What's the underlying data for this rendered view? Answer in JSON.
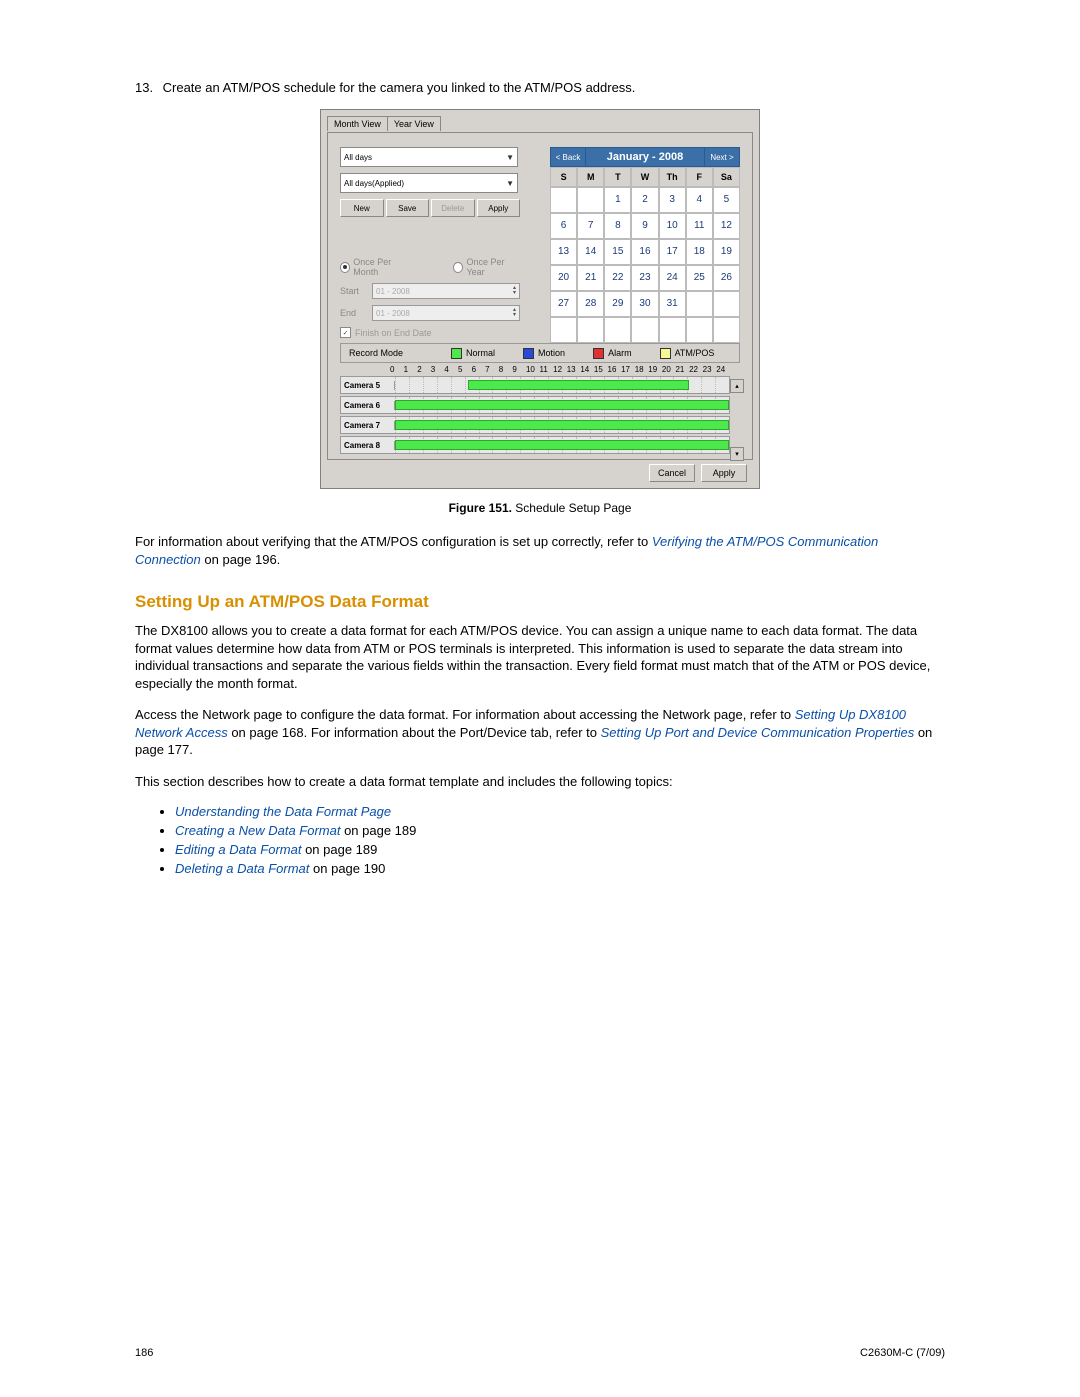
{
  "step": {
    "number": "13.",
    "text": "Create an ATM/POS schedule for the camera you linked to the ATM/POS address."
  },
  "screenshot": {
    "tabs": [
      "Month View",
      "Year View"
    ],
    "selects": [
      "All days",
      "All days(Applied)"
    ],
    "buttons": {
      "new": "New",
      "save": "Save",
      "delete": "Delete",
      "apply": "Apply"
    },
    "radios": {
      "month": "Once Per Month",
      "year": "Once Per Year"
    },
    "dates": {
      "start_label": "Start",
      "end_label": "End",
      "value": "01 - 2008"
    },
    "checkbox": "Finish on End Date",
    "calendar": {
      "back": "< Back",
      "next": "Next >",
      "title": "January - 2008",
      "dow": [
        "S",
        "M",
        "T",
        "W",
        "Th",
        "F",
        "Sa"
      ],
      "leading_blanks": 2,
      "days": [
        "1",
        "2",
        "3",
        "4",
        "5",
        "6",
        "7",
        "8",
        "9",
        "10",
        "11",
        "12",
        "13",
        "14",
        "15",
        "16",
        "17",
        "18",
        "19",
        "20",
        "21",
        "22",
        "23",
        "24",
        "25",
        "26",
        "27",
        "28",
        "29",
        "30",
        "31"
      ]
    },
    "legend": {
      "title": "Record Mode",
      "items": [
        {
          "label": "Normal",
          "class": "norm"
        },
        {
          "label": "Motion",
          "class": "motion"
        },
        {
          "label": "Alarm",
          "class": "alarm"
        },
        {
          "label": "ATM/POS",
          "class": "atm"
        }
      ]
    },
    "axis_hours": [
      "0",
      "1",
      "2",
      "3",
      "4",
      "5",
      "6",
      "7",
      "8",
      "9",
      "10",
      "11",
      "12",
      "13",
      "14",
      "15",
      "16",
      "17",
      "18",
      "19",
      "20",
      "21",
      "22",
      "23",
      "24"
    ],
    "rows": [
      {
        "name": "Camera 5",
        "start": 22,
        "end": 88
      },
      {
        "name": "Camera 6",
        "start": 0,
        "end": 100
      },
      {
        "name": "Camera 7",
        "start": 0,
        "end": 100
      },
      {
        "name": "Camera 8",
        "start": 0,
        "end": 100
      }
    ],
    "footer": {
      "cancel": "Cancel",
      "apply": "Apply"
    }
  },
  "figure": {
    "label": "Figure 151.",
    "caption": "Schedule Setup Page"
  },
  "para1": {
    "pre": "For information about verifying that the ATM/POS configuration is set up correctly, refer to ",
    "link": "Verifying the ATM/POS Communication Connection",
    "post": " on page 196."
  },
  "heading": "Setting Up an ATM/POS Data Format",
  "para2": "The DX8100 allows you to create a data format for each ATM/POS device. You can assign a unique name to each data format. The data format values determine how data from ATM or POS terminals is interpreted. This information is used to separate the data stream into individual transactions and separate the various fields within the transaction. Every field format must match that of the ATM or POS device, especially the month format.",
  "para3": {
    "pre": "Access the Network page to configure the data format. For information about accessing the Network page, refer to ",
    "link1": "Setting Up DX8100 Network Access",
    "mid": " on page 168. For information about the Port/Device tab, refer to ",
    "link2": "Setting Up Port and Device Communication Properties",
    "post": " on page 177."
  },
  "para4": "This section describes how to create a data format template and includes the following topics:",
  "topics": [
    {
      "link": "Understanding the Data Format Page",
      "tail": ""
    },
    {
      "link": "Creating a New Data Format",
      "tail": " on page 189"
    },
    {
      "link": "Editing a Data Format",
      "tail": " on page 189"
    },
    {
      "link": "Deleting a Data Format",
      "tail": " on page 190"
    }
  ],
  "footer": {
    "page": "186",
    "doc": "C2630M-C (7/09)"
  }
}
